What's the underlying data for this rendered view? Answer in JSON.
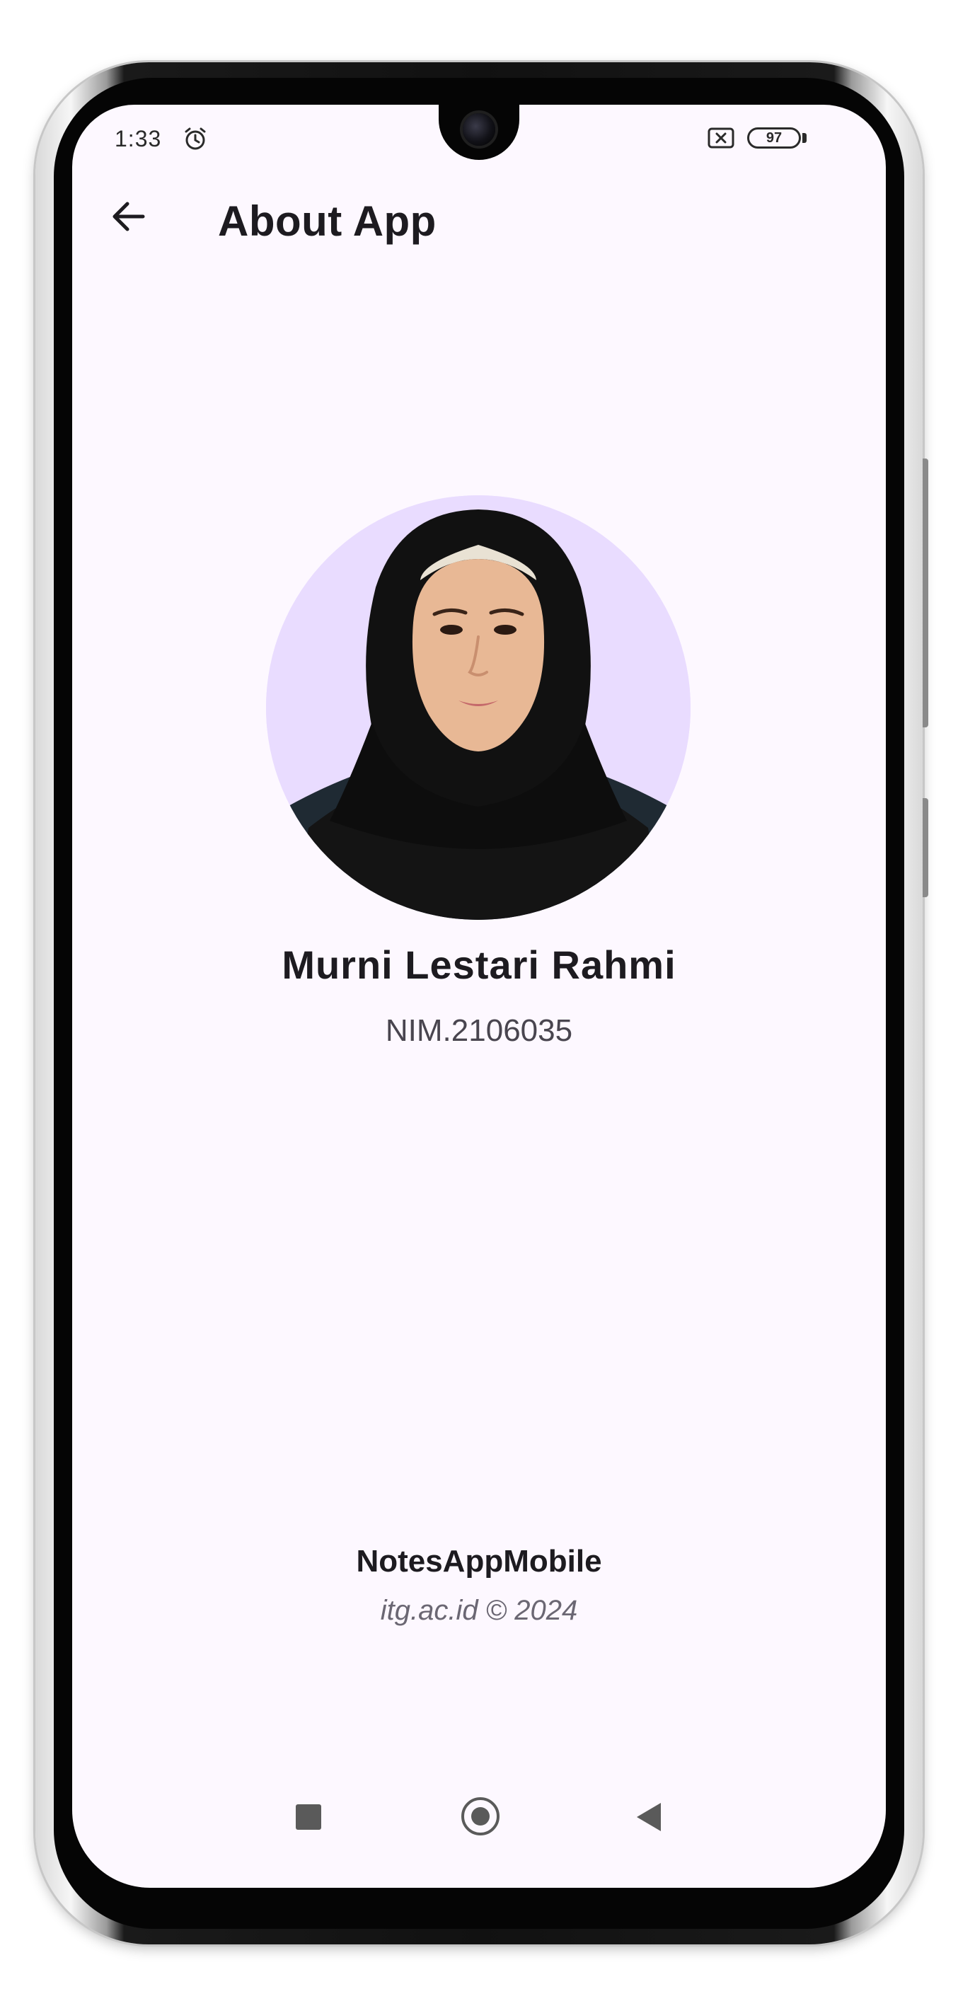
{
  "status_bar": {
    "time": "1:33",
    "battery": "97"
  },
  "app_bar": {
    "title": "About App"
  },
  "profile": {
    "name": "Murni Lestari Rahmi",
    "nim": "NIM.2106035"
  },
  "footer": {
    "app_name": "NotesAppMobile",
    "copyright": "itg.ac.id © 2024"
  },
  "colors": {
    "screen_background": "#fdf8ff",
    "avatar_background": "#e9dcff",
    "primary_text": "#1d1b20",
    "secondary_text": "#49454f"
  },
  "icons": {
    "back": "arrow-left-icon",
    "alarm": "alarm-clock-icon",
    "sim": "no-sim-icon",
    "nav_recent": "square-icon",
    "nav_home": "circle-icon",
    "nav_back": "triangle-left-icon"
  }
}
